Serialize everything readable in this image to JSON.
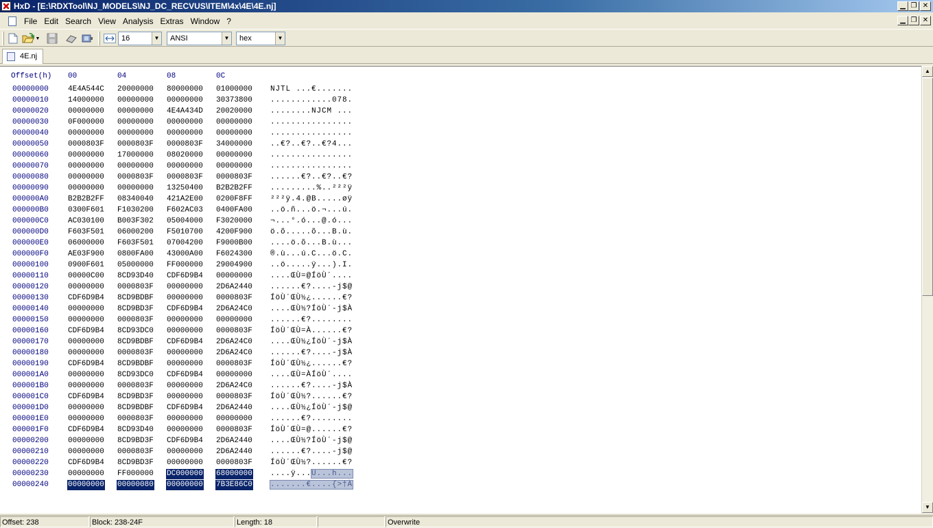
{
  "window": {
    "title": "HxD - [E:\\RDXTool\\NJ_MODELS\\NJ_DC_RECVUS\\ITEM\\4x\\4E\\4E.nj]",
    "min_glyph": "▁",
    "restore_glyph": "❐",
    "close_glyph": "✕"
  },
  "menu": [
    "File",
    "Edit",
    "Search",
    "View",
    "Analysis",
    "Extras",
    "Window",
    "?"
  ],
  "toolbar": {
    "bytes_per_row": "16",
    "charset": "ANSI",
    "display_mode": "hex",
    "dropdown_arrow": "▼"
  },
  "tab": {
    "label": "4E.nj"
  },
  "editor": {
    "header": {
      "offset_label": "Offset(h)",
      "col_00": "00",
      "col_04": "04",
      "col_08": "08",
      "col_0C": "0C"
    },
    "rows": [
      {
        "offset": "00000000",
        "hex": [
          "4E4A544C",
          "20000000",
          "80000000",
          "01000000"
        ],
        "ascii": "NJTL ...€......."
      },
      {
        "offset": "00000010",
        "hex": [
          "14000000",
          "00000000",
          "00000000",
          "30373800"
        ],
        "ascii": "............078."
      },
      {
        "offset": "00000020",
        "hex": [
          "00000000",
          "00000000",
          "4E4A434D",
          "20020000"
        ],
        "ascii": "........NJCM ..."
      },
      {
        "offset": "00000030",
        "hex": [
          "0F000000",
          "00000000",
          "00000000",
          "00000000"
        ],
        "ascii": "................"
      },
      {
        "offset": "00000040",
        "hex": [
          "00000000",
          "00000000",
          "00000000",
          "00000000"
        ],
        "ascii": "................"
      },
      {
        "offset": "00000050",
        "hex": [
          "0000803F",
          "0000803F",
          "0000803F",
          "34000000"
        ],
        "ascii": "..€?..€?..€?4..."
      },
      {
        "offset": "00000060",
        "hex": [
          "00000000",
          "17000000",
          "08020000",
          "00000000"
        ],
        "ascii": "................"
      },
      {
        "offset": "00000070",
        "hex": [
          "00000000",
          "00000000",
          "00000000",
          "00000000"
        ],
        "ascii": "................"
      },
      {
        "offset": "00000080",
        "hex": [
          "00000000",
          "0000803F",
          "0000803F",
          "0000803F"
        ],
        "ascii": "......€?..€?..€?"
      },
      {
        "offset": "00000090",
        "hex": [
          "00000000",
          "00000000",
          "13250400",
          "B2B2B2FF"
        ],
        "ascii": ".........%..²²²ÿ"
      },
      {
        "offset": "000000A0",
        "hex": [
          "B2B2B2FF",
          "08340040",
          "421A2E00",
          "0200F8FF"
        ],
        "ascii": "²²²ÿ.4.@B.....øÿ"
      },
      {
        "offset": "000000B0",
        "hex": [
          "0300F601",
          "F1030200",
          "F602AC03",
          "0400FA00"
        ],
        "ascii": "..ö.ñ...ö.¬...ú."
      },
      {
        "offset": "000000C0",
        "hex": [
          "AC030100",
          "B003F302",
          "05004000",
          "F3020000"
        ],
        "ascii": "¬...°.ó...@.ó..."
      },
      {
        "offset": "000000D0",
        "hex": [
          "F603F501",
          "06000200",
          "F5010700",
          "4200F900"
        ],
        "ascii": "ö.õ.....õ...B.ù."
      },
      {
        "offset": "000000E0",
        "hex": [
          "06000000",
          "F603F501",
          "07004200",
          "F9000B00"
        ],
        "ascii": "....ö.õ...B.ù..."
      },
      {
        "offset": "000000F0",
        "hex": [
          "AE03F900",
          "0800FA00",
          "43000A00",
          "F6024300"
        ],
        "ascii": "®.ù...ú.C...ö.C."
      },
      {
        "offset": "00000100",
        "hex": [
          "0900F601",
          "05000000",
          "FF000000",
          "29004900"
        ],
        "ascii": "..ö.....ÿ...).I."
      },
      {
        "offset": "00000110",
        "hex": [
          "00000C00",
          "8CD93D40",
          "CDF6D9B4",
          "00000000"
        ],
        "ascii": "....ŒÙ=@ÍöÙ´...."
      },
      {
        "offset": "00000120",
        "hex": [
          "00000000",
          "0000803F",
          "00000000",
          "2D6A2440"
        ],
        "ascii": "......€?....-j$@"
      },
      {
        "offset": "00000130",
        "hex": [
          "CDF6D9B4",
          "8CD9BDBF",
          "00000000",
          "0000803F"
        ],
        "ascii": "ÍöÙ´ŒÙ½¿......€?"
      },
      {
        "offset": "00000140",
        "hex": [
          "00000000",
          "8CD9BD3F",
          "CDF6D9B4",
          "2D6A24C0"
        ],
        "ascii": "....ŒÙ½?ÍöÙ´-j$À"
      },
      {
        "offset": "00000150",
        "hex": [
          "00000000",
          "0000803F",
          "00000000",
          "00000000"
        ],
        "ascii": "......€?........"
      },
      {
        "offset": "00000160",
        "hex": [
          "CDF6D9B4",
          "8CD93DC0",
          "00000000",
          "0000803F"
        ],
        "ascii": "ÍöÙ´ŒÙ=À......€?"
      },
      {
        "offset": "00000170",
        "hex": [
          "00000000",
          "8CD9BDBF",
          "CDF6D9B4",
          "2D6A24C0"
        ],
        "ascii": "....ŒÙ½¿ÍöÙ´-j$À"
      },
      {
        "offset": "00000180",
        "hex": [
          "00000000",
          "0000803F",
          "00000000",
          "2D6A24C0"
        ],
        "ascii": "......€?....-j$À"
      },
      {
        "offset": "00000190",
        "hex": [
          "CDF6D9B4",
          "8CD9BDBF",
          "00000000",
          "0000803F"
        ],
        "ascii": "ÍöÙ´ŒÙ½¿......€?"
      },
      {
        "offset": "000001A0",
        "hex": [
          "00000000",
          "8CD93DC0",
          "CDF6D9B4",
          "00000000"
        ],
        "ascii": "....ŒÙ=ÀÍöÙ´...."
      },
      {
        "offset": "000001B0",
        "hex": [
          "00000000",
          "0000803F",
          "00000000",
          "2D6A24C0"
        ],
        "ascii": "......€?....-j$À"
      },
      {
        "offset": "000001C0",
        "hex": [
          "CDF6D9B4",
          "8CD9BD3F",
          "00000000",
          "0000803F"
        ],
        "ascii": "ÍöÙ´ŒÙ½?......€?"
      },
      {
        "offset": "000001D0",
        "hex": [
          "00000000",
          "8CD9BDBF",
          "CDF6D9B4",
          "2D6A2440"
        ],
        "ascii": "....ŒÙ½¿ÍöÙ´-j$@"
      },
      {
        "offset": "000001E0",
        "hex": [
          "00000000",
          "0000803F",
          "00000000",
          "00000000"
        ],
        "ascii": "......€?........"
      },
      {
        "offset": "000001F0",
        "hex": [
          "CDF6D9B4",
          "8CD93D40",
          "00000000",
          "0000803F"
        ],
        "ascii": "ÍöÙ´ŒÙ=@......€?"
      },
      {
        "offset": "00000200",
        "hex": [
          "00000000",
          "8CD9BD3F",
          "CDF6D9B4",
          "2D6A2440"
        ],
        "ascii": "....ŒÙ½?ÍöÙ´-j$@"
      },
      {
        "offset": "00000210",
        "hex": [
          "00000000",
          "0000803F",
          "00000000",
          "2D6A2440"
        ],
        "ascii": "......€?....-j$@"
      },
      {
        "offset": "00000220",
        "hex": [
          "CDF6D9B4",
          "8CD9BD3F",
          "00000000",
          "0000803F"
        ],
        "ascii": "ÍöÙ´ŒÙ½?......€?"
      },
      {
        "offset": "00000230",
        "hex": [
          "00000000",
          "FF000000",
          "DC000000",
          "68000000"
        ],
        "ascii": "....ÿ...Ü...h..."
      },
      {
        "offset": "00000240",
        "hex": [
          "00000000",
          "00000080",
          "00000000",
          "7B3E86C0"
        ],
        "ascii": ".......€....{>†À"
      }
    ]
  },
  "scrollbar": {
    "up_glyph": "▲",
    "down_glyph": "▼"
  },
  "status": {
    "offset": "Offset: 238",
    "block": "Block: 238-24F",
    "length": "Length: 18",
    "mode": "Overwrite"
  }
}
